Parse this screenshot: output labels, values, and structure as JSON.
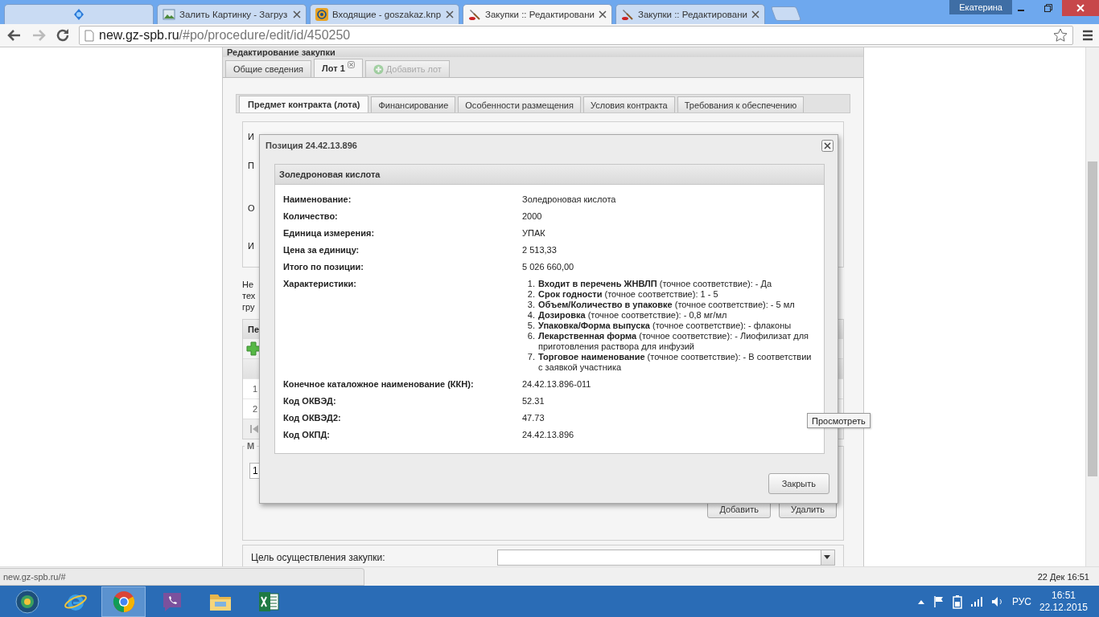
{
  "browser": {
    "tabs": [
      {
        "kind": "pinned",
        "selected": false
      },
      {
        "kind": "image",
        "title": "Залить Картинку - Загруз",
        "selected": false
      },
      {
        "kind": "mail",
        "title": "Входящие - goszakaz.knp",
        "selected": false
      },
      {
        "kind": "tools",
        "title": "Закупки :: Редактировани",
        "selected": true
      },
      {
        "kind": "tools",
        "title": "Закупки :: Редактировани",
        "selected": false
      }
    ],
    "user": "Екатерина",
    "url": {
      "host": "new.gz-spb.ru",
      "path": "/#po/procedure/edit/id/450250"
    }
  },
  "panel": {
    "title": "Редактирование закупки",
    "tabs": [
      {
        "label": "Общие сведения",
        "selected": false,
        "closable": false
      },
      {
        "label": "Лот 1",
        "selected": true,
        "closable": true
      }
    ],
    "add_tab": {
      "label": "Добавить лот",
      "disabled": true
    },
    "inner_tabs": [
      {
        "label": "Предмет контракта (лота)",
        "selected": true
      },
      {
        "label": "Финансирование",
        "selected": false
      },
      {
        "label": "Особенности размещения",
        "selected": false
      },
      {
        "label": "Условия контракта",
        "selected": false
      },
      {
        "label": "Требования к обеспечению",
        "selected": false
      }
    ],
    "fields": [
      "И",
      "П",
      "О",
      "И"
    ],
    "note": [
      "Не",
      "тех",
      "гру"
    ],
    "grid": {
      "header": "Пе",
      "rows": [
        "1",
        "2"
      ]
    },
    "fieldset": {
      "legend": "М",
      "value": "1"
    },
    "buttons": [
      "Добавить",
      "Удалить"
    ],
    "purpose": {
      "label": "Цель осуществления закупки:"
    }
  },
  "modal": {
    "title": "Позиция 24.42.13.896",
    "panel_title": "Золедроновая кислота",
    "rows": [
      {
        "kind": "text",
        "label": "Наименование:",
        "value": "Золедроновая кислота"
      },
      {
        "kind": "text",
        "label": "Количество:",
        "value": "2000"
      },
      {
        "kind": "text",
        "label": "Единица измерения:",
        "value": "УПАК"
      },
      {
        "kind": "text",
        "label": "Цена за единицу:",
        "value": "2 513,33"
      },
      {
        "kind": "text",
        "label": "Итого по позиции:",
        "value": "5 026 660,00"
      },
      {
        "kind": "list",
        "label": "Характеристики:",
        "items": [
          {
            "number": "1.",
            "text": "**Входит в перечень ЖНВЛП** (точное соответствие): - Да"
          },
          {
            "number": "2.",
            "text": "**Срок годности** (точное соответствие): 1 - 5"
          },
          {
            "number": "3.",
            "text": "**Объем/Количество в упаковке** (точное соответствие): - 5 мл"
          },
          {
            "number": "4.",
            "text": "**Дозировка** (точное соответствие): - 0,8 мг/мл"
          },
          {
            "number": "5.",
            "text": "**Упаковка/Форма выпуска** (точное соответствие): - флаконы"
          },
          {
            "number": "6.",
            "text": "**Лекарственная форма** (точное соответствие): - Лиофилизат для приготовления раствора для инфузий"
          },
          {
            "number": "7.",
            "text": "**Торговое наименование** (точное соответствие): - В соответствии с заявкой участника"
          }
        ]
      },
      {
        "kind": "text",
        "label": "Конечное каталожное наименование (ККН):",
        "value": "24.42.13.896-011"
      },
      {
        "kind": "text",
        "label": "Код ОКВЭД:",
        "value": "52.31"
      },
      {
        "kind": "text",
        "label": "Код ОКВЭД2:",
        "value": "47.73"
      },
      {
        "kind": "text",
        "label": "Код ОКПД:",
        "value": "24.42.13.896"
      }
    ],
    "button": "Закрыть"
  },
  "tooltip": "Просмотреть",
  "status_bubble": "new.gz-spb.ru/#",
  "footer_date": "22 Дек 16:51",
  "taskbar": {
    "apps": [
      {
        "kind": "ie",
        "selected": false
      },
      {
        "kind": "chrome",
        "selected": true
      },
      {
        "kind": "viber",
        "selected": false
      },
      {
        "kind": "explorer",
        "selected": false
      },
      {
        "kind": "excel",
        "selected": false
      }
    ],
    "language": "РУС",
    "time": "16:51",
    "date": "22.12.2015"
  }
}
